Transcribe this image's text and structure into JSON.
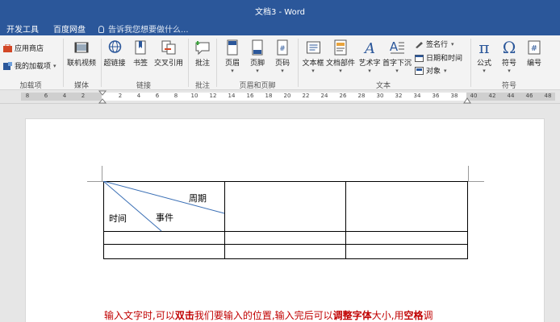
{
  "window": {
    "title": "文档3 - Word"
  },
  "tabs": [
    "开发工具",
    "百度网盘"
  ],
  "tell_me": {
    "placeholder": "告诉我您想要做什么..."
  },
  "ribbon": {
    "groups": {
      "addins": "加载项",
      "media": "媒体",
      "links": "链接",
      "comments": "批注",
      "header_footer": "页眉和页脚",
      "text": "文本",
      "symbols": "符号"
    },
    "addins": {
      "store": "应用商店",
      "my_addins": "我的加载项"
    },
    "media": {
      "online_video": "联机视频"
    },
    "links": {
      "hyperlink": "超链接",
      "bookmark": "书签",
      "cross_reference": "交叉引用"
    },
    "comments": {
      "comment": "批注"
    },
    "header_footer": {
      "header": "页眉",
      "footer": "页脚",
      "page_number": "页码"
    },
    "text": {
      "textbox": "文本框",
      "quick_parts": "文档部件",
      "wordart": "艺术字",
      "dropcap": "首字下沉",
      "signature_line": "签名行",
      "date_time": "日期和时间",
      "object": "对象"
    },
    "symbols": {
      "equation": "公式",
      "symbol": "符号",
      "number": "编号"
    }
  },
  "ruler": {
    "left_numbers": [
      "8",
      "6",
      "4",
      "2"
    ],
    "right_numbers": [
      "2",
      "4",
      "6",
      "8",
      "10",
      "12",
      "14",
      "16",
      "18",
      "20",
      "22",
      "24",
      "26",
      "28",
      "30",
      "32",
      "34",
      "36",
      "38",
      "40",
      "42",
      "44",
      "46",
      "48"
    ]
  },
  "document": {
    "table": {
      "header_top_right": "周期",
      "header_bottom_left": "时间",
      "header_bottom_middle": "事件"
    },
    "note_parts": {
      "p1": "输入文字时,可以",
      "b1": "双击",
      "p2": "我们要输入的位置,输入完后可以",
      "b2": "调整字体",
      "p3": "大小,用",
      "b3": "空格",
      "p4": "调"
    }
  },
  "colors": {
    "title_bar": "#2b579a",
    "ribbon": "#f3f3f3",
    "accent_blue": "#2b579a",
    "note_red": "#c00000"
  }
}
